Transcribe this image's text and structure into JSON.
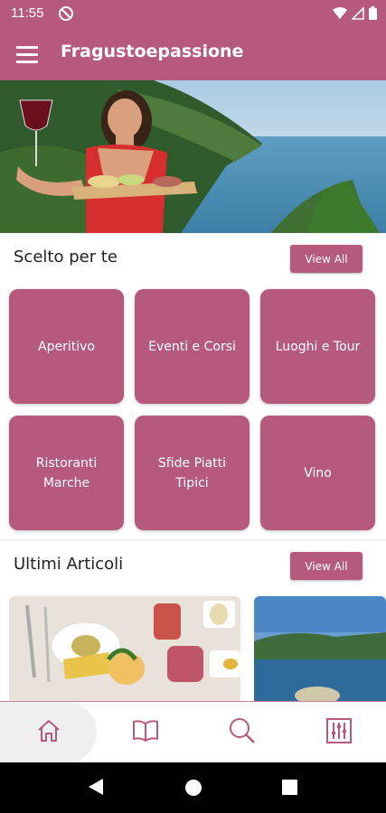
{
  "status_bar": {
    "time": "11:55",
    "icons": [
      "no-disturb-icon",
      "wifi-icon",
      "signal-icon",
      "battery-icon"
    ]
  },
  "app_bar": {
    "title": "Fragustoepassione",
    "menu_icon": "hamburger-menu-icon"
  },
  "hero": {
    "image": "hero-photo-woman-wine-coast"
  },
  "picked": {
    "title": "Scelto per te",
    "view_all": "View All",
    "tiles": [
      {
        "label": "Aperitivo"
      },
      {
        "label": "Eventi e Corsi"
      },
      {
        "label": "Luoghi e Tour"
      },
      {
        "label": "Ristoranti\nMarche"
      },
      {
        "label": "Sfide Piatti\nTipici"
      },
      {
        "label": "Vino"
      }
    ]
  },
  "articles": {
    "title": "Ultimi Articoli",
    "view_all": "View All",
    "cards": [
      {
        "image": "food-table-photo"
      },
      {
        "image": "sea-coast-photo"
      }
    ]
  },
  "bottom_nav": {
    "items": [
      {
        "icon": "home-icon",
        "active": true
      },
      {
        "icon": "book-icon",
        "active": false
      },
      {
        "icon": "search-icon",
        "active": false
      },
      {
        "icon": "filter-settings-icon",
        "active": false
      }
    ]
  },
  "colors": {
    "primary": "#b55a7d",
    "icon": "#b55a7d"
  }
}
